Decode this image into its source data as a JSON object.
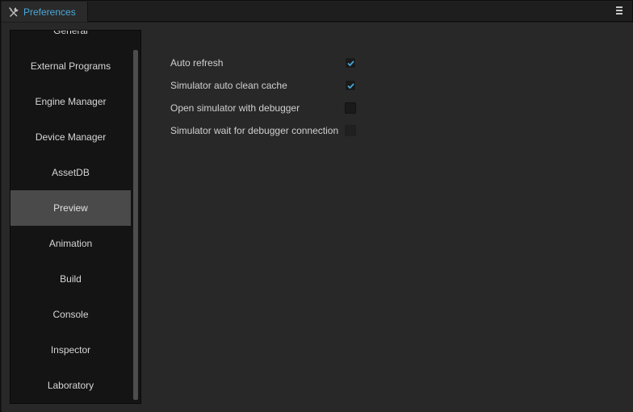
{
  "window": {
    "tab_title": "Preferences"
  },
  "colors": {
    "accent": "#4aa8d8",
    "active_item_bg": "#4a4a4a",
    "panel_bg": "#282828",
    "sidebar_bg": "#141414"
  },
  "sidebar": {
    "items": [
      {
        "label": "General"
      },
      {
        "label": "External Programs"
      },
      {
        "label": "Engine Manager"
      },
      {
        "label": "Device Manager"
      },
      {
        "label": "AssetDB"
      },
      {
        "label": "Preview",
        "active": true
      },
      {
        "label": "Animation"
      },
      {
        "label": "Build"
      },
      {
        "label": "Console"
      },
      {
        "label": "Inspector"
      },
      {
        "label": "Laboratory"
      }
    ]
  },
  "settings": [
    {
      "label": "Auto refresh",
      "checked": true
    },
    {
      "label": "Simulator auto clean cache",
      "checked": true
    },
    {
      "label": "Open simulator with debugger",
      "checked": false
    },
    {
      "label": "Simulator wait for debugger connection",
      "checked": false,
      "disabled": true
    }
  ]
}
